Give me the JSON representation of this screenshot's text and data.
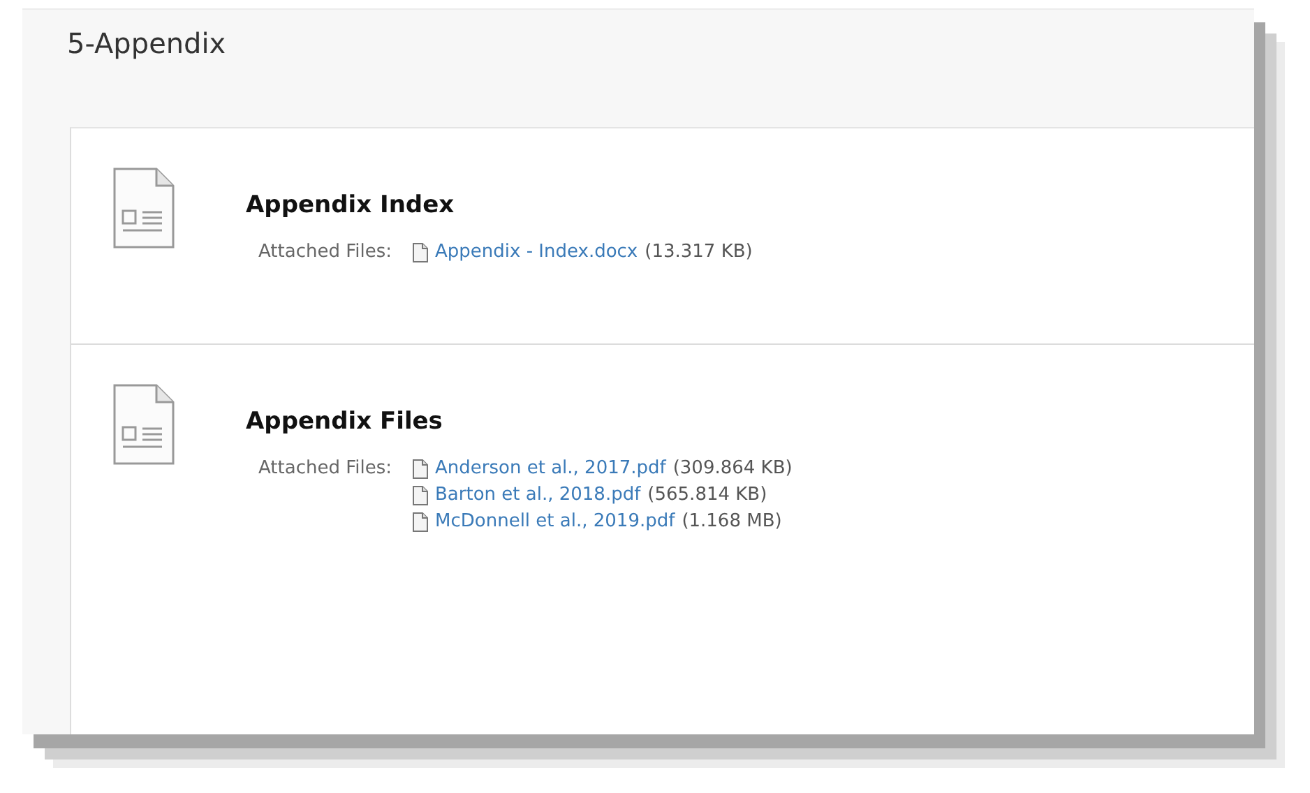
{
  "section": {
    "title": "5-Appendix"
  },
  "items": [
    {
      "title": "Appendix Index",
      "attachments_label": "Attached Files:",
      "files": [
        {
          "name": "Appendix - Index.docx",
          "size": "(13.317 KB)"
        }
      ]
    },
    {
      "title": "Appendix Files",
      "attachments_label": "Attached Files:",
      "files": [
        {
          "name": "Anderson et al., 2017.pdf",
          "size": "(309.864 KB)"
        },
        {
          "name": "Barton et al., 2018.pdf",
          "size": "(565.814 KB)"
        },
        {
          "name": "McDonnell et al., 2019.pdf",
          "size": "(1.168 MB)"
        }
      ]
    }
  ]
}
